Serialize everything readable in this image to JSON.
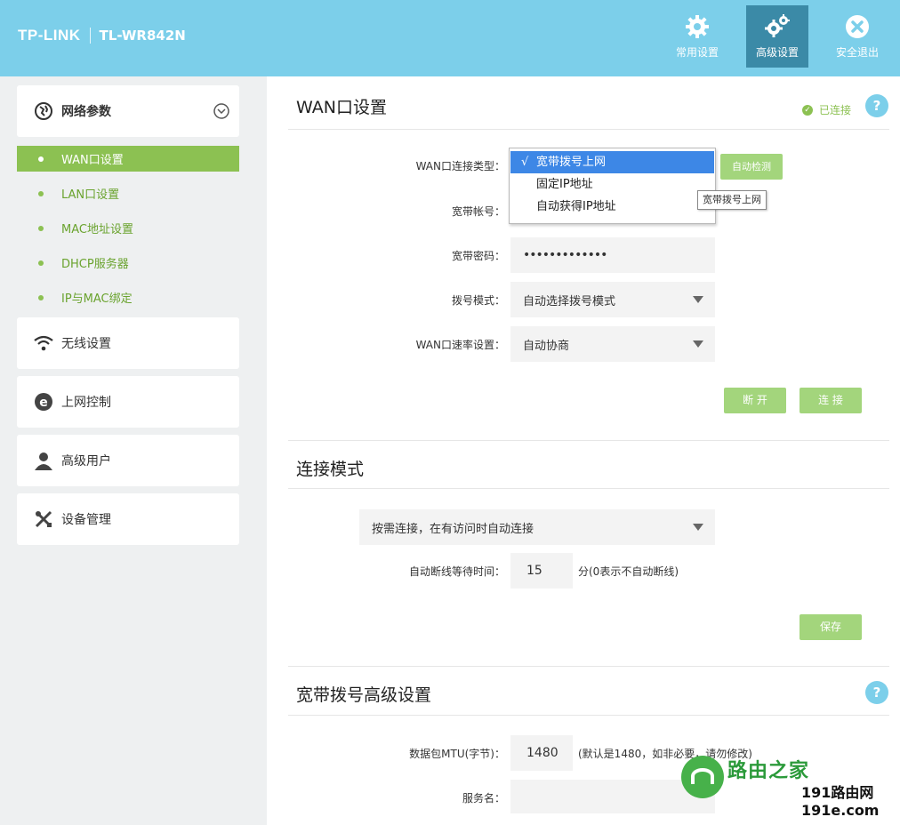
{
  "header": {
    "logo": "TP-LINK",
    "model": "TL-WR842N",
    "buttons": [
      {
        "label": "常用设置",
        "icon": "gear-icon"
      },
      {
        "label": "高级设置",
        "icon": "gears-icon",
        "active": true
      },
      {
        "label": "安全退出",
        "icon": "close-circle-icon"
      }
    ]
  },
  "sidebar": {
    "network_group": "网络参数",
    "subitems": [
      "WAN口设置",
      "LAN口设置",
      "MAC地址设置",
      "DHCP服务器",
      "IP与MAC绑定"
    ],
    "groups": [
      "无线设置",
      "上网控制",
      "高级用户",
      "设备管理"
    ]
  },
  "wan": {
    "title": "WAN口设置",
    "status": "已连接",
    "conn_type_label": "WAN口连接类型：",
    "conn_type_options": [
      "宽带拨号上网",
      "固定IP地址",
      "自动获得IP地址"
    ],
    "selected_check": "√",
    "tooltip": "宽带拨号上网",
    "detect_button": "自动检测",
    "account_label": "宽带帐号：",
    "password_label": "宽带密码：",
    "password_value": "•••••••••••••",
    "dial_mode_label": "拨号模式：",
    "dial_mode_value": "自动选择拨号模式",
    "speed_label": "WAN口速率设置：",
    "speed_value": "自动协商",
    "disconnect_button": "断 开",
    "connect_button": "连 接"
  },
  "mode": {
    "title": "连接模式",
    "mode_value": "按需连接，在有访问时自动连接",
    "idle_label": "自动断线等待时间：",
    "idle_value": "15",
    "idle_note": "分(0表示不自动断线)",
    "save_button": "保存"
  },
  "advanced": {
    "title": "宽带拨号高级设置",
    "mtu_label": "数据包MTU(字节)：",
    "mtu_value": "1480",
    "mtu_note": "(默认是1480，如非必要，请勿修改)",
    "service_label": "服务名："
  },
  "watermark": {
    "site_name": "路由之家",
    "domain_line1": "191路由网",
    "domain_line2": "191e.com"
  },
  "colors": {
    "header": "#7ccfea",
    "active_header_button": "#3b8aa7",
    "green": "#8cc152",
    "button_green": "#a3d57c",
    "help_blue": "#7ccfea",
    "select_blue": "#3d87e6"
  }
}
